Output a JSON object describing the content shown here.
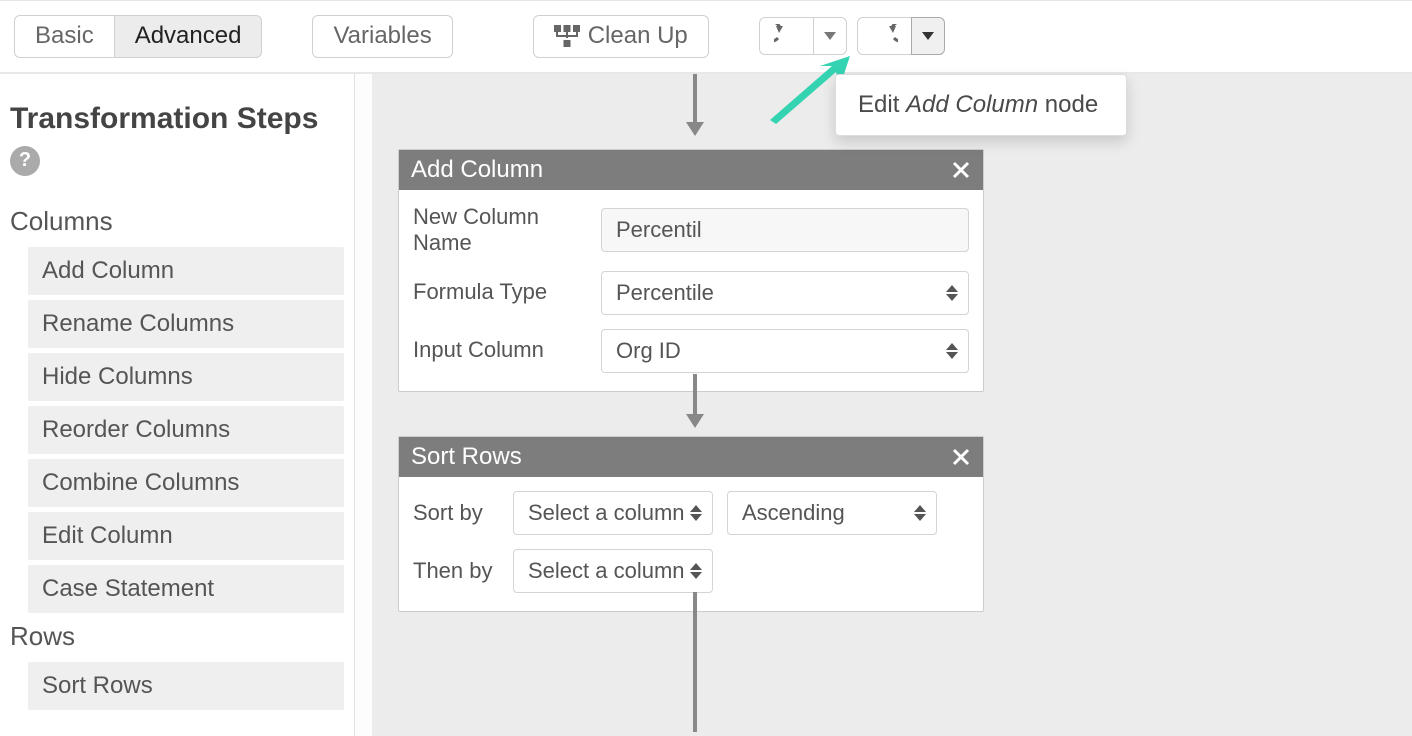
{
  "toolbar": {
    "basic_label": "Basic",
    "advanced_label": "Advanced",
    "variables_label": "Variables",
    "cleanup_label": "Clean Up"
  },
  "sidebar": {
    "title": "Transformation Steps",
    "columns_heading": "Columns",
    "rows_heading": "Rows",
    "columns_items": [
      "Add Column",
      "Rename Columns",
      "Hide Columns",
      "Reorder Columns",
      "Combine Columns",
      "Edit Column",
      "Case Statement"
    ],
    "rows_items": [
      "Sort Rows"
    ]
  },
  "popover": {
    "prefix": "Edit ",
    "em": "Add Column",
    "suffix": " node"
  },
  "nodes": {
    "add_column": {
      "title": "Add Column",
      "new_column_name_label": "New Column Name",
      "new_column_name_value": "Percentil",
      "formula_type_label": "Formula Type",
      "formula_type_value": "Percentile",
      "input_column_label": "Input Column",
      "input_column_value": "Org ID"
    },
    "sort_rows": {
      "title": "Sort Rows",
      "sort_by_label": "Sort by",
      "then_by_label": "Then by",
      "column_placeholder": "Select a column",
      "order_value": "Ascending"
    }
  }
}
